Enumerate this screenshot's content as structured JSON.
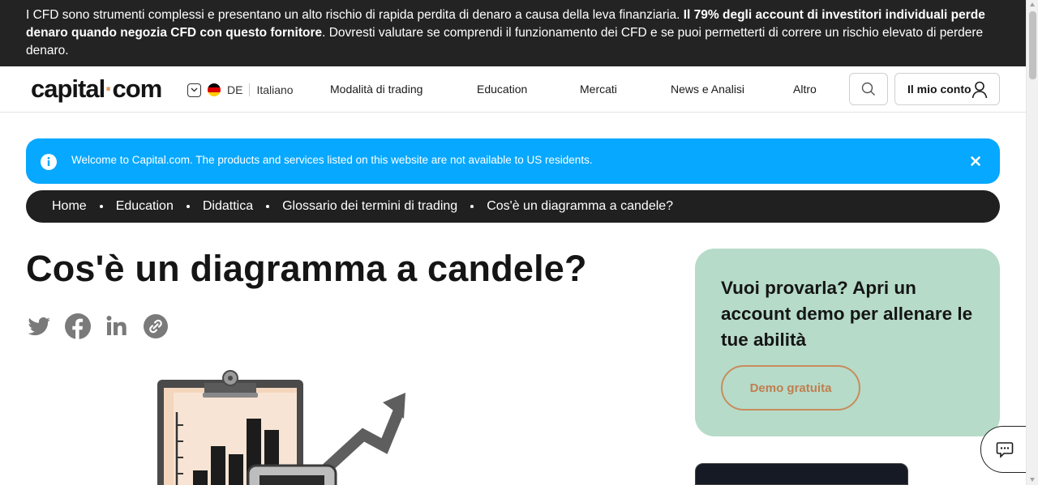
{
  "risk_banner": {
    "text_a": "I CFD sono strumenti complessi e presentano un alto rischio di rapida perdita di denaro a causa della leva finanziaria. ",
    "text_bold": "Il 79% degli account di investitori individuali perde denaro quando negozia CFD con questo fornitore",
    "text_b": ". Dovresti valutare se comprendi il funzionamento dei CFD e se puoi permetterti di correre un rischio elevato di perdere denaro."
  },
  "header": {
    "logo_main": "capital",
    "logo_dot": "·",
    "logo_end": "com",
    "country": "DE",
    "language": "Italiano",
    "nav": [
      "Modalità di trading",
      "Education",
      "Mercati",
      "News e Analisi",
      "Altro"
    ],
    "account_label": "Il mio conto",
    "search_icon": "search-icon",
    "user_icon": "user-icon"
  },
  "alert": {
    "message": "Welcome to Capital.com. The products and services listed on this website are not available to US residents.",
    "color": "#07a8ff"
  },
  "breadcrumb": [
    "Home",
    "Education",
    "Didattica",
    "Glossario dei termini di trading",
    "Cos'è un diagramma a candele?"
  ],
  "article": {
    "title": "Cos'è un diagramma a candele?",
    "share_icons": [
      "twitter-icon",
      "facebook-icon",
      "linkedin-icon",
      "copy-link-icon"
    ]
  },
  "demo_card": {
    "heading": "Vuoi provarla? Apri un account demo per allenare le tue abilità",
    "button": "Demo gratuita",
    "background": "#b6dbc9"
  }
}
